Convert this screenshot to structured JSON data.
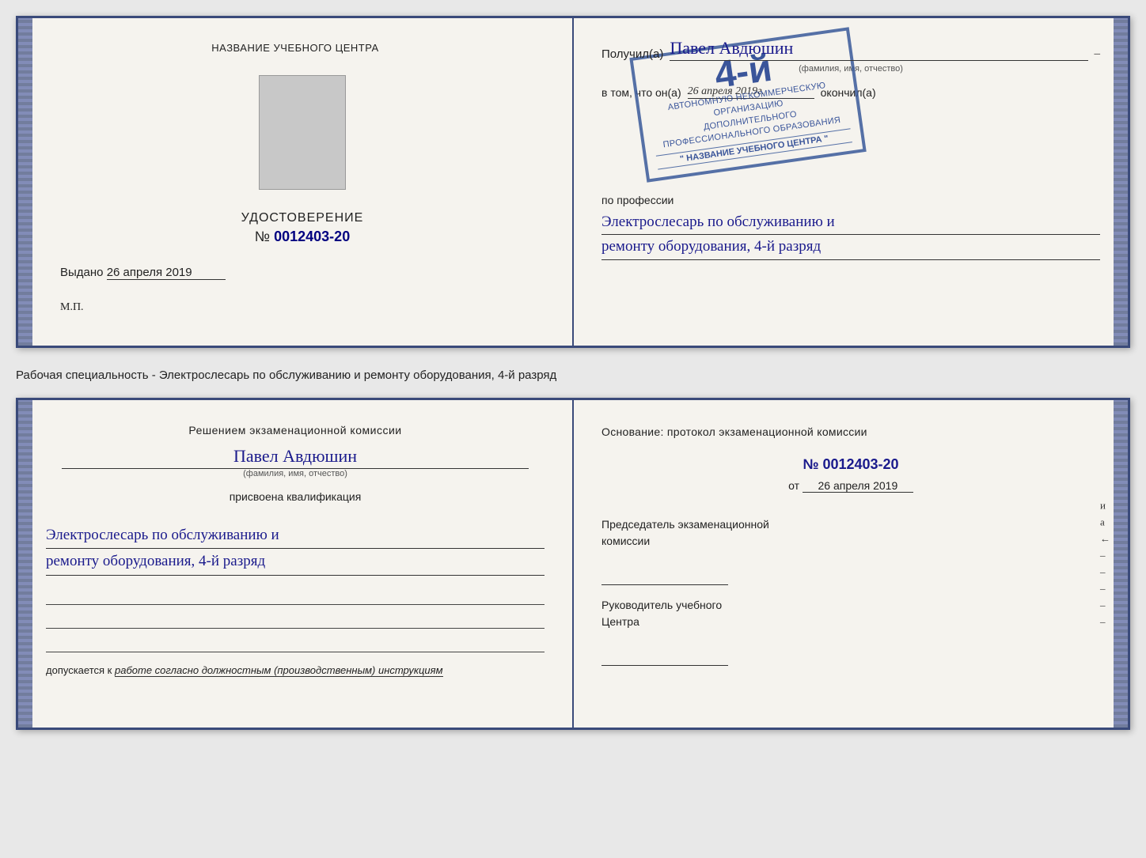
{
  "top": {
    "left": {
      "org_name": "НАЗВАНИЕ УЧЕБНОГО ЦЕНТРА",
      "cert_title": "УДОСТОВЕРЕНИЕ",
      "cert_number_prefix": "№",
      "cert_number": "0012403-20",
      "issued_label": "Выдано",
      "issued_date": "26 апреля 2019",
      "mp": "М.П."
    },
    "right": {
      "recipient_label": "Получил(а)",
      "recipient_name": "Павел Авдюшин",
      "recipient_dash": "–",
      "fio_label": "(фамилия, имя, отчество)",
      "vtom_text": "в том, что он(а)",
      "date_value": "26 апреля 2019г.",
      "okonchil": "окончил(а)",
      "stamp_grade": "4-й",
      "stamp_line1": "АВТОНОМНУЮ НЕКОММЕРЧЕСКУЮ ОРГАНИЗАЦИЮ",
      "stamp_line2": "ДОПОЛНИТЕЛЬНОГО ПРОФЕССИОНАЛЬНОГО ОБРАЗОВАНИЯ",
      "stamp_name": "\" НАЗВАНИЕ УЧЕБНОГО ЦЕНТРА \"",
      "po_professii": "по профессии",
      "profession_line1": "Электрослесарь по обслуживанию и",
      "profession_line2": "ремонту оборудования, 4-й разряд"
    }
  },
  "middle": {
    "text": "Рабочая специальность - Электрослесарь по обслуживанию и ремонту оборудования, 4-й разряд"
  },
  "bottom": {
    "left": {
      "decision_title": "Решением экзаменационной комиссии",
      "person_name": "Павел Авдюшин",
      "fio_label": "(фамилия, имя, отчество)",
      "prisvoena": "присвоена квалификация",
      "qual_line1": "Электрослесарь по обслуживанию и",
      "qual_line2": "ремонту оборудования, 4-й разряд",
      "dopusk_label": "допускается к",
      "dopusk_text": "работе согласно должностным (производственным) инструкциям"
    },
    "right": {
      "osnov_label": "Основание: протокол экзаменационной комиссии",
      "protocol_number": "№  0012403-20",
      "ot_label": "от",
      "ot_date": "26 апреля 2019",
      "chairman_role_line1": "Председатель экзаменационной",
      "chairman_role_line2": "комиссии",
      "director_role_line1": "Руководитель учебного",
      "director_role_line2": "Центра"
    },
    "right_edge_letters": [
      "и",
      "а",
      "←",
      "–",
      "–",
      "–",
      "–",
      "–"
    ]
  }
}
